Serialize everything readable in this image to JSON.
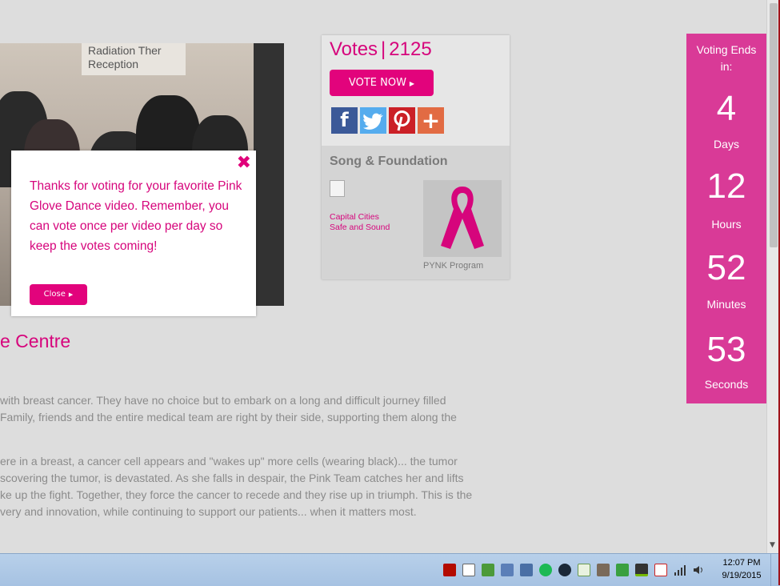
{
  "video": {
    "sign_text_1": "Radiation Ther",
    "sign_text_2": "Reception"
  },
  "modal": {
    "message": "Thanks for voting for your favorite Pink Glove Dance video. Remember, you can vote once per video per day so keep the votes coming!",
    "close_label": "Close",
    "close_icon": "close-x-icon"
  },
  "page_title": "e Centre",
  "paragraphs": [
    [
      "with breast cancer.   They have no choice but to embark on a long and difficult journey filled",
      "Family, friends and the entire medical team are right by their side, supporting them along the"
    ],
    [
      "ere in a breast, a cancer cell appears and \"wakes up\" more cells (wearing black)... the tumor",
      "scovering the tumor,  is devastated. As she falls in despair, the Pink Team catches her and lifts",
      "ke up the fight.  Together, they force the cancer to recede and they rise up in triumph.  This is the",
      "very and innovation, while continuing to support our patients... when it matters most."
    ]
  ],
  "votes": {
    "label": "Votes",
    "separator": "|",
    "count": "2125",
    "vote_button": "VOTE NOW",
    "social": [
      {
        "name": "facebook-icon",
        "glyph": "f",
        "color": "#3b5998"
      },
      {
        "name": "twitter-icon",
        "glyph": "t",
        "color": "#55acee"
      },
      {
        "name": "pinterest-icon",
        "glyph": "P",
        "color": "#cb2027"
      },
      {
        "name": "share-plus-icon",
        "glyph": "+",
        "color": "#e26b43"
      }
    ]
  },
  "song": {
    "title": "Song & Foundation",
    "link_line1": "Capital Cities",
    "link_line2": "Safe and Sound",
    "program_label": "PYNK Program"
  },
  "countdown": {
    "heading_line1": "Voting Ends",
    "heading_line2": "in:",
    "days": "4",
    "days_label": "Days",
    "hours": "12",
    "hours_label": "Hours",
    "minutes": "52",
    "minutes_label": "Minutes",
    "seconds": "53",
    "seconds_label": "Seconds"
  },
  "taskbar": {
    "time": "12:07 PM",
    "date": "9/19/2015"
  },
  "colors": {
    "brand_pink": "#e2037c",
    "countdown_bg": "#d93a97"
  }
}
